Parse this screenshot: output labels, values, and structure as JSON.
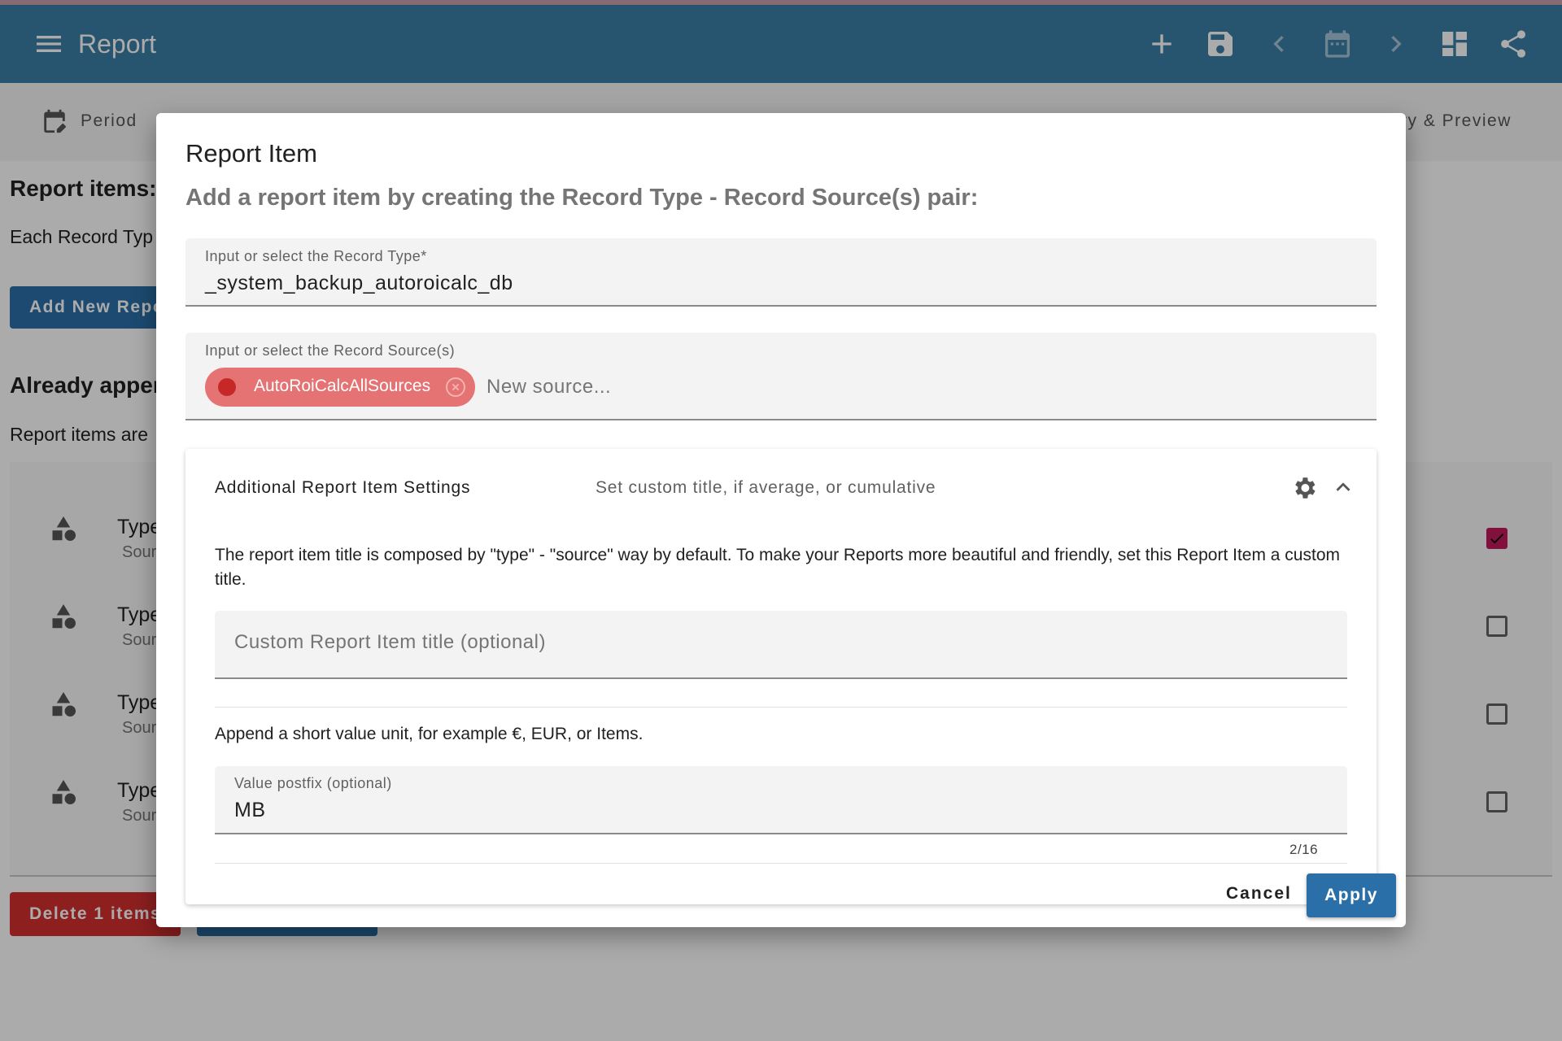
{
  "appbar": {
    "title": "Report"
  },
  "tabs": [
    {
      "label": "Period"
    },
    {
      "label": "ry & Preview"
    }
  ],
  "page": {
    "report_items_heading": "Report items:",
    "report_items_text": "Each Record Typ",
    "add_new_button": "Add New Repo",
    "already_heading": "Already appen",
    "already_text": "Report items are",
    "delete_button": "Delete 1 items"
  },
  "list": {
    "rows": [
      {
        "type": "Type",
        "source": "Sour",
        "checked": true
      },
      {
        "type": "Type",
        "source": "Sour",
        "checked": false
      },
      {
        "type": "Type",
        "source": "Sour",
        "checked": false
      },
      {
        "type": "Type",
        "source": "Sour",
        "checked": false
      }
    ]
  },
  "dialog": {
    "title": "Report Item",
    "subtitle": "Add a report item by creating the Record Type - Record Source(s) pair:",
    "record_type": {
      "label": "Input or select the Record Type*",
      "value": "_system_backup_autoroicalc_db"
    },
    "record_source": {
      "label": "Input or select the Record Source(s)",
      "chip": "AutoRoiCalcAllSources",
      "placeholder": "New source..."
    },
    "settings": {
      "heading": "Additional Report Item Settings",
      "description": "Set custom title, if average, or cumulative",
      "title_info": "The report item title is composed by \"type\" - \"source\" way by default. To make your Reports more beautiful and friendly, set this Report Item a custom title.",
      "custom_title_placeholder": "Custom Report Item title (optional)",
      "postfix_info": "Append a short value unit, for example €, EUR, or Items.",
      "postfix_label": "Value postfix (optional)",
      "postfix_value": "MB",
      "postfix_counter": "2/16"
    },
    "actions": {
      "cancel": "Cancel",
      "apply": "Apply"
    }
  },
  "colors": {
    "primary": "#3b7ea6",
    "button_blue": "#2a6fa8",
    "danger": "#d32f2f",
    "chip": "#e57373",
    "checkbox_checked": "#c2185b"
  }
}
